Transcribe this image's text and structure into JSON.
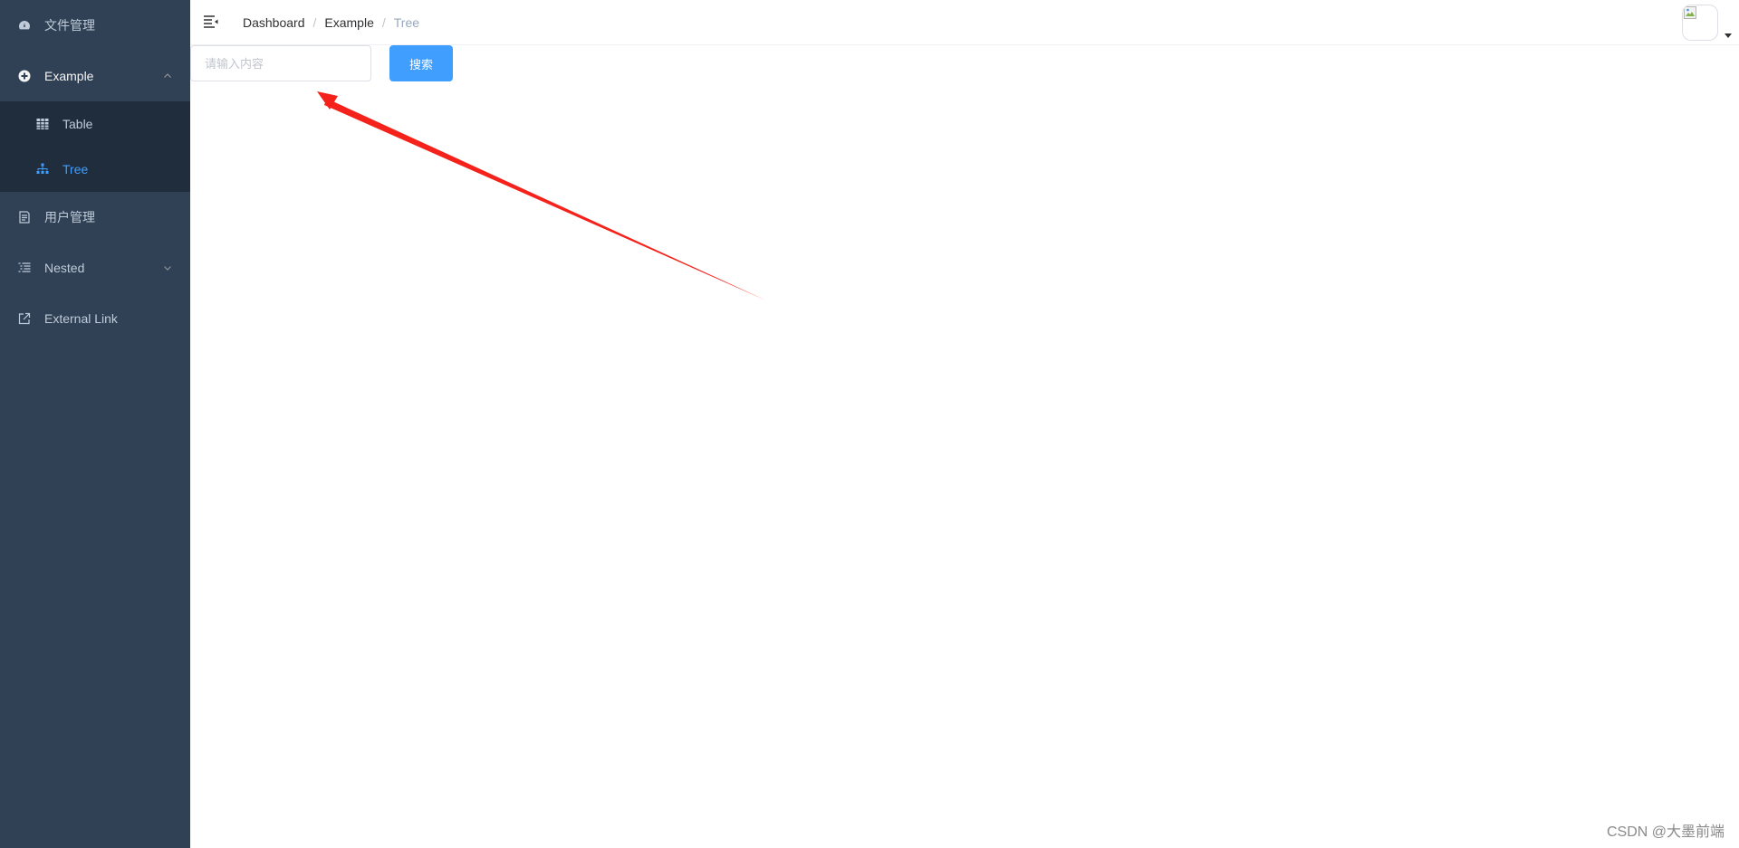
{
  "sidebar": {
    "items": [
      {
        "label": "文件管理",
        "icon": "dashboard-icon"
      },
      {
        "label": "Example",
        "icon": "example-icon",
        "open": true,
        "children": [
          {
            "label": "Table",
            "icon": "table-icon"
          },
          {
            "label": "Tree",
            "icon": "tree-icon",
            "active": true
          }
        ]
      },
      {
        "label": "用户管理",
        "icon": "form-icon"
      },
      {
        "label": "Nested",
        "icon": "nested-icon"
      },
      {
        "label": "External Link",
        "icon": "link-icon"
      }
    ]
  },
  "navbar": {
    "breadcrumb": [
      "Dashboard",
      "Example",
      "Tree"
    ],
    "separator": "/"
  },
  "search": {
    "placeholder": "请输入内容",
    "value": "",
    "button_label": "搜索"
  },
  "watermark": "CSDN @大墨前端",
  "colors": {
    "sidebar_bg": "#304156",
    "submenu_bg": "#1f2d3d",
    "sidebar_text": "#bfcbd9",
    "active": "#409eff",
    "annotation_arrow": "#f5221b"
  }
}
